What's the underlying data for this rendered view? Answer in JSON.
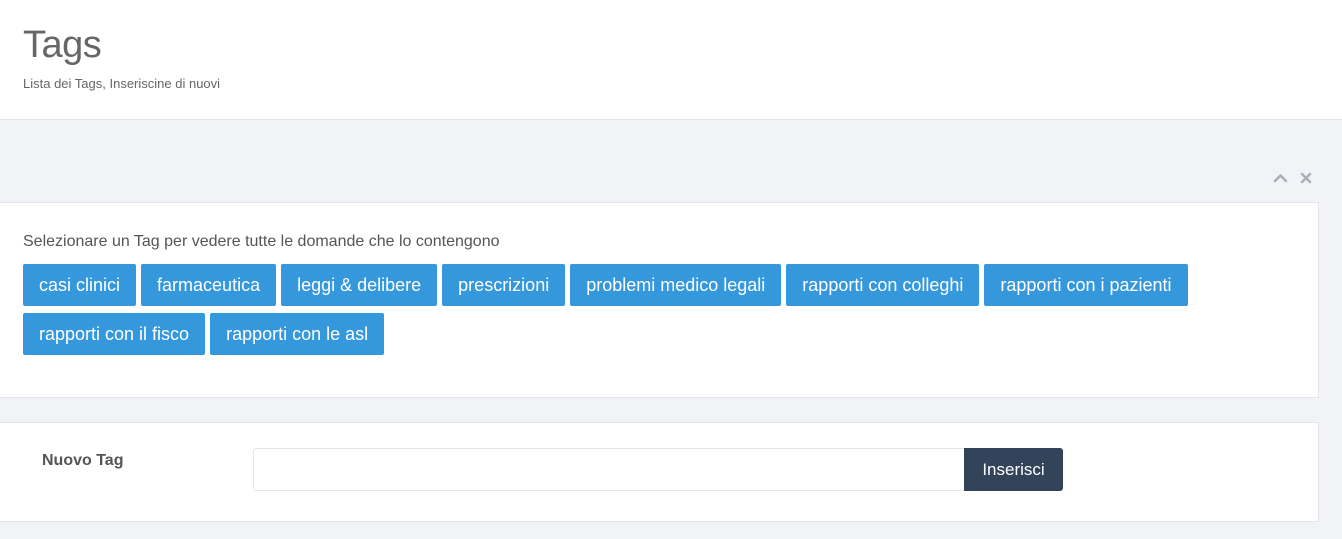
{
  "header": {
    "title": "Tags",
    "subtitle": "Lista dei Tags, Inseriscine di nuovi"
  },
  "portlet_tools": {
    "collapse_icon": "chevron-up-icon",
    "remove_icon": "close-icon"
  },
  "tags_section": {
    "hint": "Selezionare un Tag per vedere tutte le domande che lo contengono",
    "tags": [
      "casi clinici",
      "farmaceutica",
      "leggi & delibere",
      "prescrizioni",
      "problemi medico legali",
      "rapporti con colleghi",
      "rapporti con i pazienti",
      "rapporti con il fisco",
      "rapporti con le asl"
    ]
  },
  "new_tag_form": {
    "label": "Nuovo Tag",
    "input_value": "",
    "input_placeholder": "",
    "submit_label": "Inserisci"
  },
  "colors": {
    "tag_button": "#3598dc",
    "submit_button": "#32435a",
    "page_background": "#f2f3f7"
  }
}
